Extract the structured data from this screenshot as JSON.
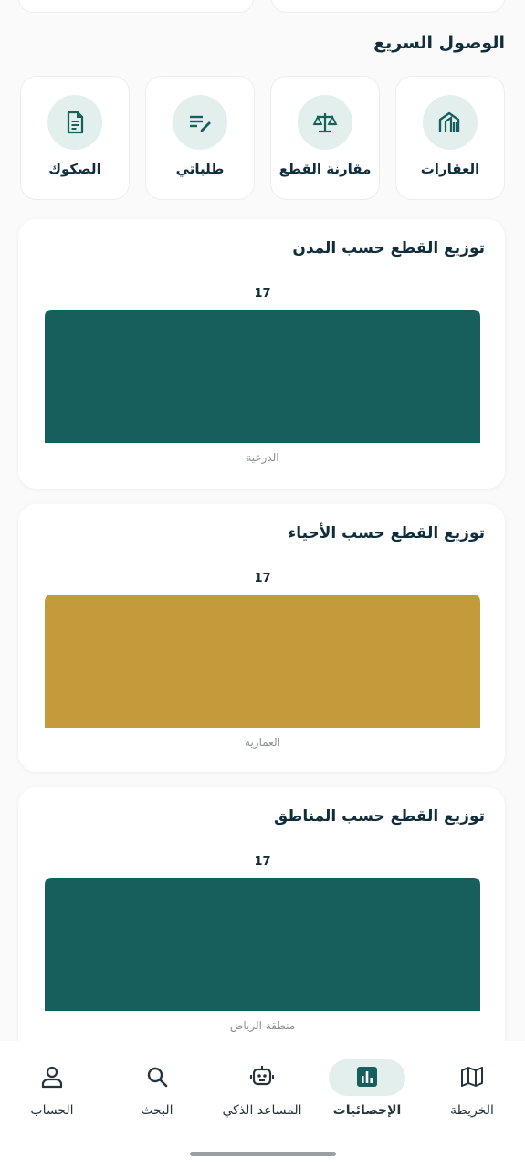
{
  "colors": {
    "teal": "#175f5d",
    "gold": "#c59a3a",
    "dark_text": "#0f2d3a",
    "icon_bg": "#e3efed"
  },
  "quick_access": {
    "title": "الوصول السريع",
    "items": [
      {
        "label": "العقارات",
        "icon": "buildings-icon"
      },
      {
        "label": "مقارنة القطع",
        "icon": "scale-icon"
      },
      {
        "label": "طلباتي",
        "icon": "edit-list-icon"
      },
      {
        "label": "الصكوك",
        "icon": "document-icon"
      }
    ]
  },
  "charts": [
    {
      "title": "توزيع القطع حسب المدن"
    },
    {
      "title": "توزيع القطع حسب الأحياء"
    },
    {
      "title": "توزيع القطع حسب المناطق"
    }
  ],
  "chart_data": [
    {
      "type": "bar",
      "title": "توزيع القطع حسب المدن",
      "categories": [
        "الدرعية"
      ],
      "values": [
        17
      ],
      "color": "#175f5d",
      "ylim": [
        0,
        17
      ]
    },
    {
      "type": "bar",
      "title": "توزيع القطع حسب الأحياء",
      "categories": [
        "العمارية"
      ],
      "values": [
        17
      ],
      "color": "#c59a3a",
      "ylim": [
        0,
        17
      ]
    },
    {
      "type": "bar",
      "title": "توزيع القطع حسب المناطق",
      "categories": [
        "منطقة الرياض"
      ],
      "values": [
        17
      ],
      "color": "#175f5d",
      "ylim": [
        0,
        17
      ]
    }
  ],
  "bottom_nav": {
    "items": [
      {
        "label": "الخريطة",
        "icon": "map-icon",
        "active": false
      },
      {
        "label": "الإحصائيات",
        "icon": "bar-chart-icon",
        "active": true
      },
      {
        "label": "المساعد الذكي",
        "icon": "robot-icon",
        "active": false
      },
      {
        "label": "البحث",
        "icon": "search-icon",
        "active": false
      },
      {
        "label": "الحساب",
        "icon": "user-icon",
        "active": false
      }
    ]
  }
}
